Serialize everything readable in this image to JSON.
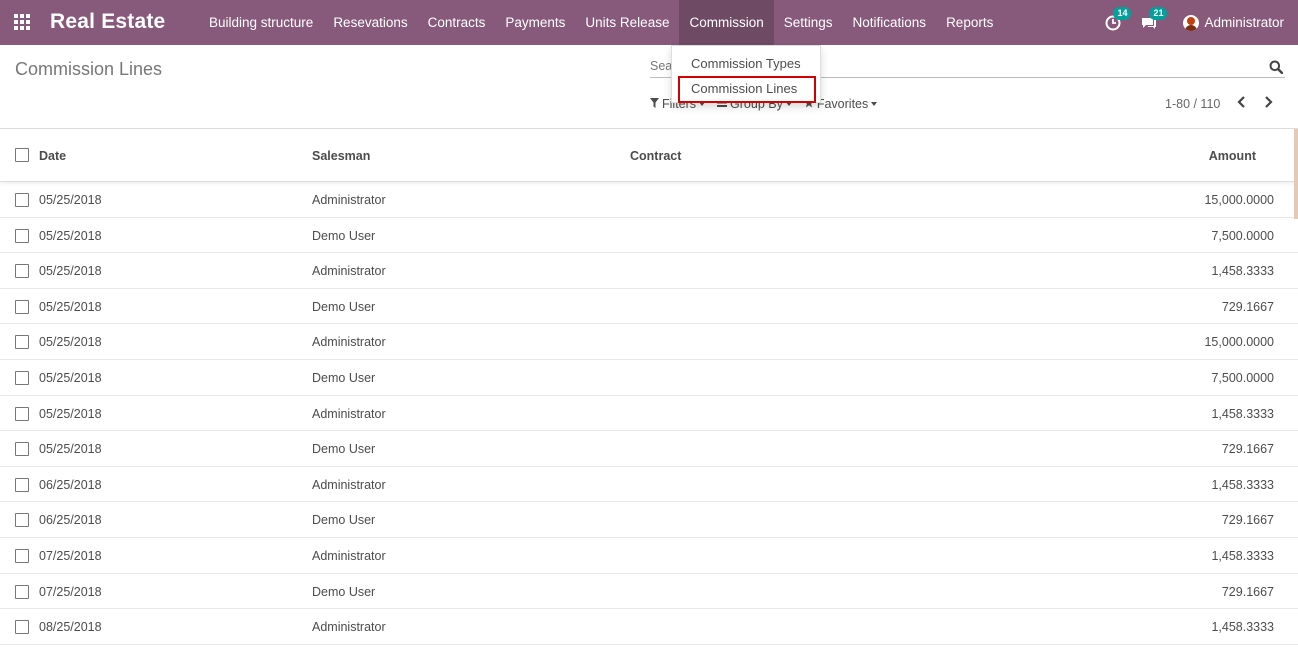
{
  "app": {
    "brand": "Real Estate",
    "menu": [
      {
        "label": "Building structure",
        "active": false
      },
      {
        "label": "Resevations",
        "active": false
      },
      {
        "label": "Contracts",
        "active": false
      },
      {
        "label": "Payments",
        "active": false
      },
      {
        "label": "Units Release",
        "active": false
      },
      {
        "label": "Commission",
        "active": true
      },
      {
        "label": "Settings",
        "active": false
      },
      {
        "label": "Notifications",
        "active": false
      },
      {
        "label": "Reports",
        "active": false
      }
    ],
    "systray": {
      "activity_count": "14",
      "messages_count": "21",
      "user_name": "Administrator"
    },
    "colors": {
      "navbar": "#875A7B",
      "badge": "#00A09D",
      "highlight": "#d00000"
    }
  },
  "dropdown": {
    "items": [
      "Commission Types",
      "Commission Lines"
    ],
    "highlighted_item": "Commission Lines"
  },
  "control_panel": {
    "breadcrumb": "Commission Lines",
    "search_placeholder": "Search...",
    "filters_label": "Filters",
    "groupby_label": "Group By",
    "favorites_label": "Favorites",
    "pager": "1-80 / 110"
  },
  "table": {
    "headers": {
      "date": "Date",
      "salesman": "Salesman",
      "contract": "Contract",
      "amount": "Amount"
    },
    "rows": [
      {
        "date": "05/25/2018",
        "salesman": "Administrator",
        "contract": "",
        "amount": "15,000.0000"
      },
      {
        "date": "05/25/2018",
        "salesman": "Demo User",
        "contract": "",
        "amount": "7,500.0000"
      },
      {
        "date": "05/25/2018",
        "salesman": "Administrator",
        "contract": "",
        "amount": "1,458.3333"
      },
      {
        "date": "05/25/2018",
        "salesman": "Demo User",
        "contract": "",
        "amount": "729.1667"
      },
      {
        "date": "05/25/2018",
        "salesman": "Administrator",
        "contract": "",
        "amount": "15,000.0000"
      },
      {
        "date": "05/25/2018",
        "salesman": "Demo User",
        "contract": "",
        "amount": "7,500.0000"
      },
      {
        "date": "05/25/2018",
        "salesman": "Administrator",
        "contract": "",
        "amount": "1,458.3333"
      },
      {
        "date": "05/25/2018",
        "salesman": "Demo User",
        "contract": "",
        "amount": "729.1667"
      },
      {
        "date": "06/25/2018",
        "salesman": "Administrator",
        "contract": "",
        "amount": "1,458.3333"
      },
      {
        "date": "06/25/2018",
        "salesman": "Demo User",
        "contract": "",
        "amount": "729.1667"
      },
      {
        "date": "07/25/2018",
        "salesman": "Administrator",
        "contract": "",
        "amount": "1,458.3333"
      },
      {
        "date": "07/25/2018",
        "salesman": "Demo User",
        "contract": "",
        "amount": "729.1667"
      },
      {
        "date": "08/25/2018",
        "salesman": "Administrator",
        "contract": "",
        "amount": "1,458.3333"
      }
    ]
  }
}
